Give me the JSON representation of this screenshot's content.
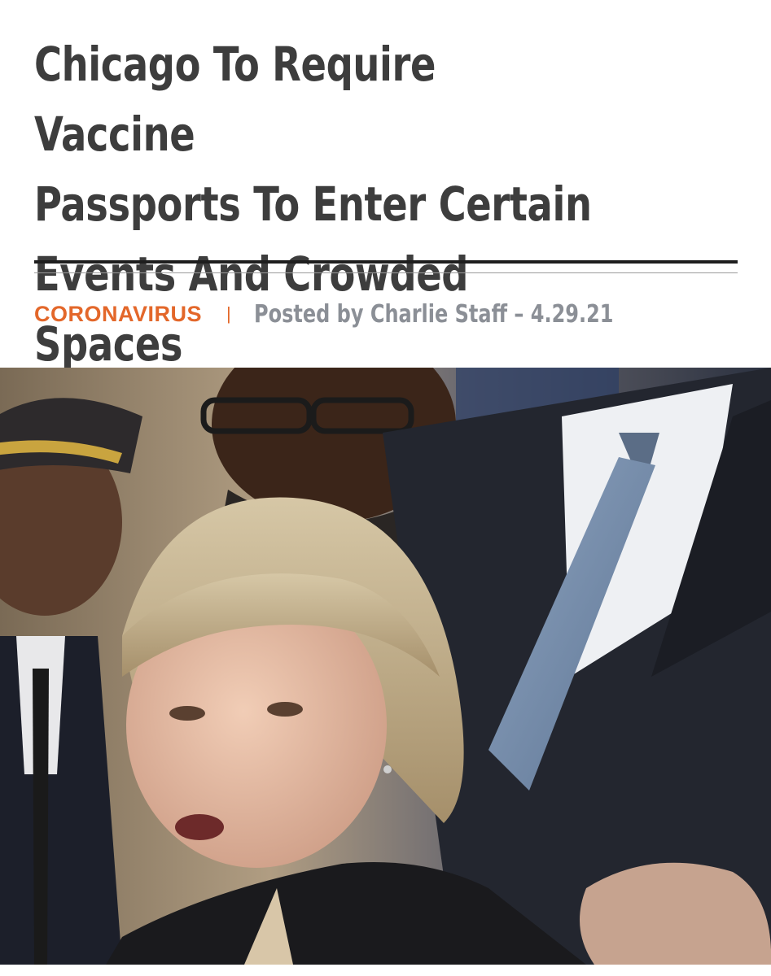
{
  "article": {
    "headline": "Chicago To Require Vaccine\nPassports To Enter Certain\nEvents And Crowded Spaces",
    "category": "CORONAVIRUS",
    "separator": "|",
    "byline": "Posted by Charlie Staff – 4.29.21"
  },
  "colors": {
    "headline": "#3d3d3d",
    "category": "#e3672a",
    "byline": "#8b8f96",
    "rule": "#1e1e1e"
  }
}
